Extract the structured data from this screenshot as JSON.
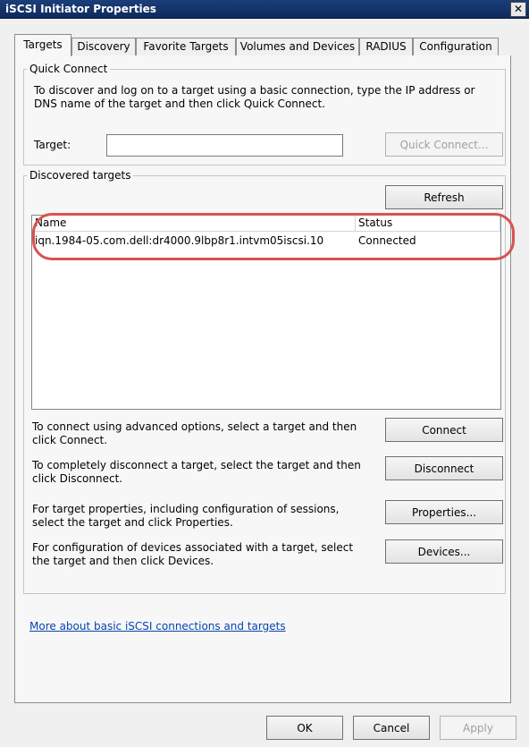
{
  "window": {
    "title": "iSCSI Initiator Properties",
    "close_glyph": "✕"
  },
  "tabs": [
    {
      "label": "Targets"
    },
    {
      "label": "Discovery"
    },
    {
      "label": "Favorite Targets"
    },
    {
      "label": "Volumes and Devices"
    },
    {
      "label": "RADIUS"
    },
    {
      "label": "Configuration"
    }
  ],
  "quick_connect": {
    "group_label": "Quick Connect",
    "description": "To discover and log on to a target using a basic connection, type the IP address or DNS name of the target and then click Quick Connect.",
    "target_label": "Target:",
    "target_value": "",
    "button_label": "Quick Connect..."
  },
  "discovered": {
    "group_label": "Discovered targets",
    "refresh_label": "Refresh",
    "columns": [
      "Name",
      "Status"
    ],
    "rows": [
      {
        "name": "iqn.1984-05.com.dell:dr4000.9lbp8r1.intvm05iscsi.10",
        "status": "Connected"
      }
    ],
    "actions": [
      {
        "text": "To connect using advanced options, select a target and then click Connect.",
        "button": "Connect"
      },
      {
        "text": "To completely disconnect a target, select the target and then click Disconnect.",
        "button": "Disconnect"
      },
      {
        "text": "For target properties, including configuration of sessions, select the target and click Properties.",
        "button": "Properties..."
      },
      {
        "text": "For configuration of devices associated with a target, select the target and then click Devices.",
        "button": "Devices..."
      }
    ]
  },
  "link": {
    "text": "More about basic iSCSI connections and targets"
  },
  "footer": {
    "ok": "OK",
    "cancel": "Cancel",
    "apply": "Apply"
  },
  "colors": {
    "titlebar": "#0e2a5c",
    "highlight": "#d9534f",
    "link": "#0645ad"
  }
}
